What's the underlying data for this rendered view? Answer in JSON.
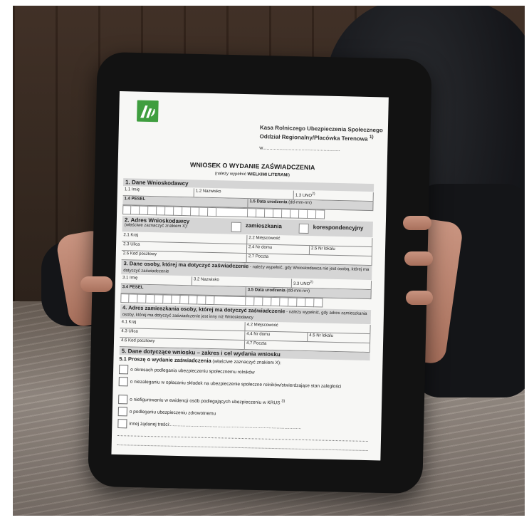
{
  "form": {
    "org_line1": "Kasa Rolniczego Ubezpieczenia Społecznego",
    "org_line2": "Oddział Regionalny/Placówka Terenowa",
    "org_sup": "1)",
    "w_label": "w",
    "title": "WNIOSEK O WYDANIE ZAŚWIADCZENIA",
    "subtitle_pre": "(należy wypełnić ",
    "subtitle_bold": "WIELKIMI LITERAMI",
    "subtitle_post": ")",
    "s1": "1.  Dane Wnioskodawcy",
    "s1_imie": "1.1 Imię",
    "s1_nazwisko": "1.2 Nazwisko",
    "s1_uno": "1.3 UNO",
    "s1_pesel": "1.4 PESEL",
    "s1_dob": "1.5 Data urodzenia",
    "s1_dob_fmt": "(dd-mm-rrrr)",
    "s2": "2.  Adres Wnioskodawcy",
    "s2_note": "(właściwe zaznaczyć znakiem X):",
    "s2_opt1": "zamieszkania",
    "s2_opt2": "korespondencyjny",
    "s2_kraj": "2.1 Kraj",
    "s2_miejsc": "2.2 Miejscowość",
    "s2_ulica": "2.3 Ulica",
    "s2_nrdomu": "2.4 Nr domu",
    "s2_nrlokalu": "2.5 Nr lokalu",
    "s2_kod": "2.6 Kod pocztowy",
    "s2_poczta": "2.7 Poczta",
    "s3": "3.  Dane osoby, której ma dotyczyć zaświadczenie",
    "s3_note": " - należy wypełnić, gdy Wnioskodawca nie jest osobą, której ma dotyczyć zaświadczenie",
    "s3_imie": "3.1 Imię",
    "s3_nazwisko": "3.2 Nazwisko",
    "s3_uno": "3.3 UNO",
    "s3_pesel": "3.4 PESEL",
    "s3_dob": "3.5 Data urodzenia",
    "s3_dob_fmt": "(dd-mm-rrrr)",
    "s4": "4.  Adres zamieszkania osoby, której ma dotyczyć zaświadczenie",
    "s4_note": " - należy wypełnić, gdy adres zamieszkania osoby, której ma dotyczyć zaświadczenie jest inny niż Wnioskodawcy",
    "s4_kraj": "4.1 Kraj",
    "s4_miejsc": "4.2 Miejscowość",
    "s4_ulica": "4.3 Ulica",
    "s4_nrdomu": "4.4 Nr domu",
    "s4_nrlokalu": "4.5 Nr lokalu",
    "s4_kod": "4.6 Kod pocztowy",
    "s4_poczta": "4.7 Poczta",
    "s5": "5.  Dane dotyczące wniosku – zakres i cel wydania wniosku",
    "s51": "5.1 Proszę o wydanie zaświadczenia",
    "s51_note": " (właściwe zaznaczyć znakiem X):",
    "opt1": "o okresach podlegania ubezpieczeniu społecznemu rolników",
    "opt2": "o niezaleganiu w opłacaniu składek na ubezpieczenie społeczne rolników/stwierdzające stan zaległości",
    "opt3": "o niefigurowaniu w ewidencji osób podlegających ubezpieczeniu w KRUS",
    "opt3_sup": "3)",
    "opt4": "o podleganiu ubezpieczeniu zdrowotnemu",
    "opt5": "innej żądanej treści:"
  },
  "colors": {
    "logo_green": "#3f9e3f",
    "section_grey": "#d5d5d5"
  }
}
